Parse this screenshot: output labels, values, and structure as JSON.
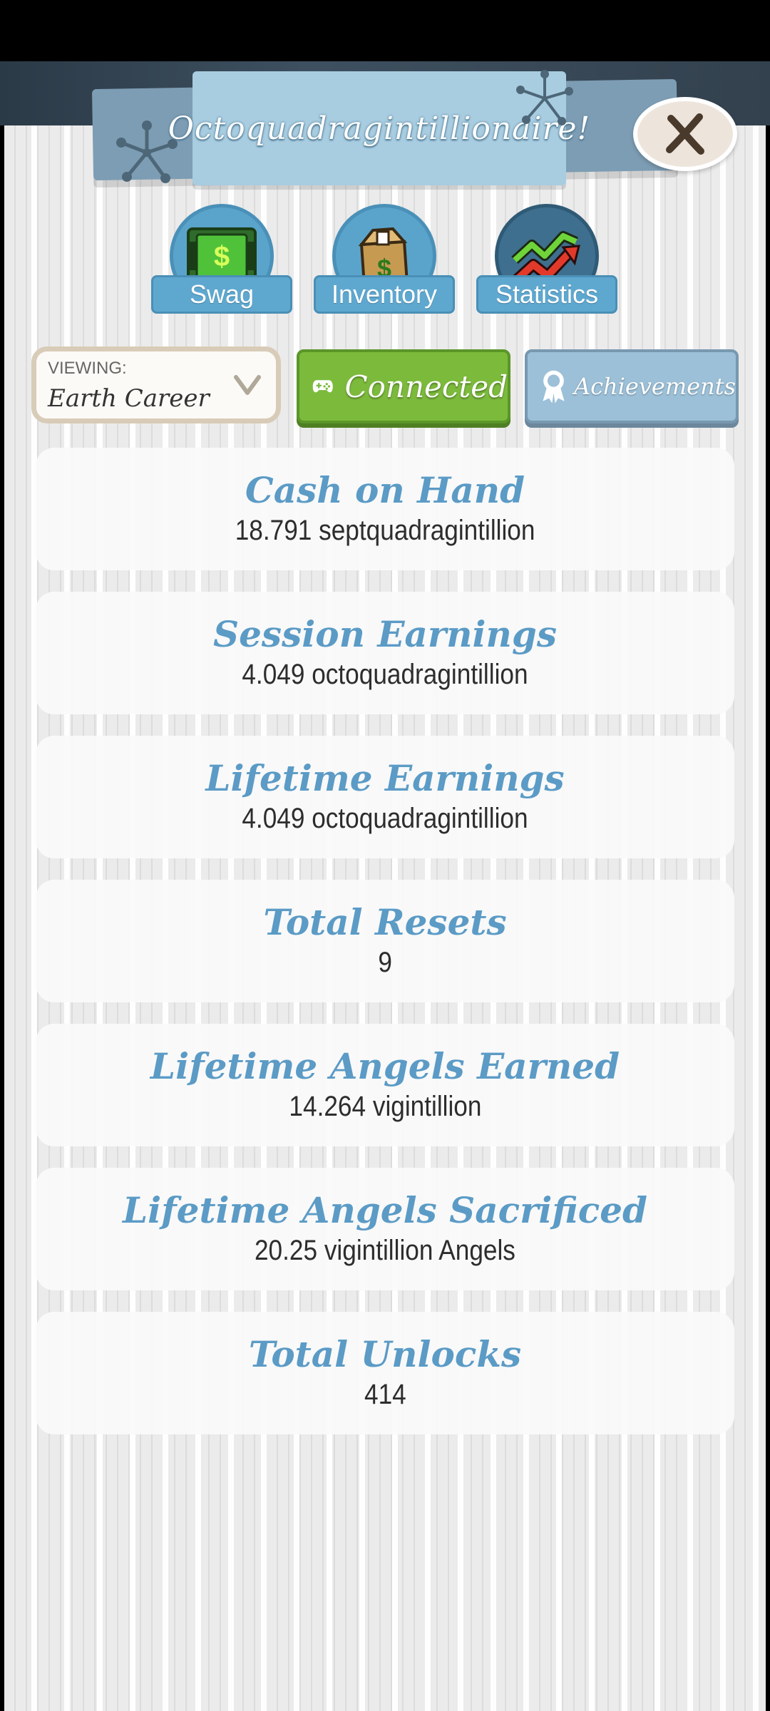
{
  "header": {
    "title": "Octoquadragintillionaire!",
    "close_label": "X"
  },
  "tabs": [
    {
      "label": "Swag",
      "icon": "cash-icon"
    },
    {
      "label": "Inventory",
      "icon": "box-icon"
    },
    {
      "label": "Statistics",
      "icon": "chart-arrows-icon"
    }
  ],
  "viewing": {
    "label": "VIEWING:",
    "value": "Earth Career"
  },
  "connected_label": "Connected",
  "achievements_label": "Achievements",
  "stats": [
    {
      "title": "Cash on Hand",
      "value": "18.791 septquadragintillion"
    },
    {
      "title": "Session Earnings",
      "value": "4.049 octoquadragintillion"
    },
    {
      "title": "Lifetime Earnings",
      "value": "4.049 octoquadragintillion"
    },
    {
      "title": "Total Resets",
      "value": "9"
    },
    {
      "title": "Lifetime Angels Earned",
      "value": "14.264 vigintillion"
    },
    {
      "title": "Lifetime Angels Sacrificed",
      "value": "20.25 vigintillion Angels"
    },
    {
      "title": "Total Unlocks",
      "value": "414"
    }
  ],
  "colors": {
    "accent_blue": "#5b9bc6",
    "connected_green": "#7cba3c",
    "achievements_blue": "#9cc0d8"
  }
}
